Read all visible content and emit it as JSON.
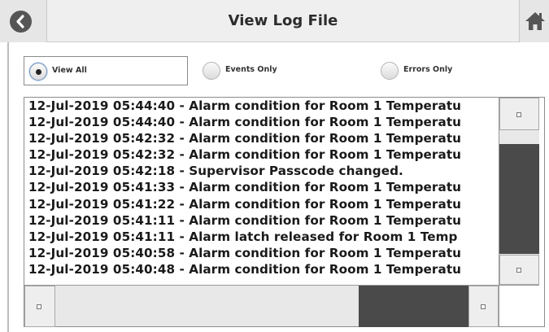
{
  "header": {
    "title": "View Log File",
    "back_icon": "back-arrow-icon",
    "home_icon": "home-icon"
  },
  "filter": {
    "selected": "View All",
    "options": [
      {
        "label": "View All",
        "selected": true
      },
      {
        "label": "Events Only",
        "selected": false
      },
      {
        "label": "Errors Only",
        "selected": false
      }
    ]
  },
  "log": {
    "lines": [
      "12-Jul-2019 05:44:40 - Alarm condition for Room 1 Temperatu",
      "12-Jul-2019 05:44:40 - Alarm condition for Room 1 Temperatu",
      "12-Jul-2019 05:42:32 - Alarm condition for Room 1 Temperatu",
      "12-Jul-2019 05:42:32 - Alarm condition for Room 1 Temperatu",
      "12-Jul-2019 05:42:18 - Supervisor Passcode changed.",
      "12-Jul-2019 05:41:33 - Alarm condition for Room 1 Temperatu",
      "12-Jul-2019 05:41:22 - Alarm condition for Room 1 Temperatu",
      "12-Jul-2019 05:41:11 - Alarm condition for Room 1 Temperatu",
      "12-Jul-2019 05:41:11 - Alarm latch released for Room 1 Temp",
      "12-Jul-2019 05:40:58 - Alarm condition for Room 1 Temperatu",
      "12-Jul-2019 05:40:48 - Alarm condition for Room 1 Temperatu"
    ]
  },
  "colors": {
    "scroll_thumb": "#4a4a4a",
    "header_bg": "#efefef",
    "icon": "#555555"
  }
}
